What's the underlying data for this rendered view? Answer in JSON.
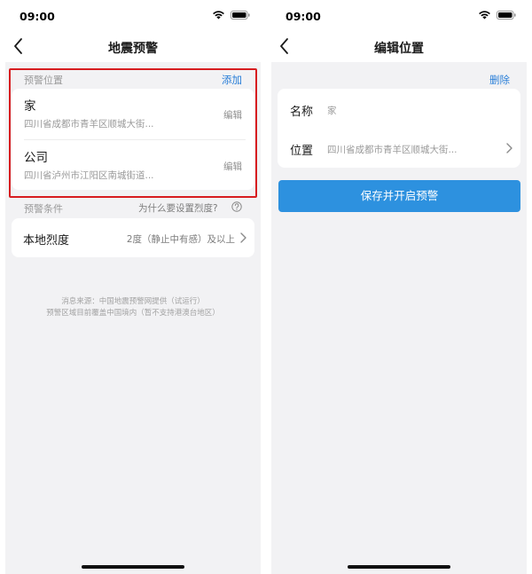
{
  "status_bar": {
    "time": "09:00"
  },
  "left_screen": {
    "title": "地震预警",
    "warning_location": {
      "section_label": "预警位置",
      "add_label": "添加",
      "items": [
        {
          "name": "家",
          "address": "四川省成都市青羊区顺城大街...",
          "edit_label": "编辑"
        },
        {
          "name": "公司",
          "address": "四川省泸州市江阳区南城街道...",
          "edit_label": "编辑"
        }
      ]
    },
    "warning_condition": {
      "section_label": "预警条件",
      "why_label": "为什么要设置烈度?"
    },
    "local_intensity": {
      "label": "本地烈度",
      "value": "2度（静止中有感）及以上"
    },
    "footer": {
      "line1": "消息来源：中国地震预警网提供（试运行）",
      "line2": "预警区域目前覆盖中国境内（暂不支持港澳台地区）"
    }
  },
  "right_screen": {
    "title": "编辑位置",
    "delete_label": "删除",
    "name_field": {
      "label": "名称",
      "value": "家"
    },
    "location_field": {
      "label": "位置",
      "value": "四川省成都市青羊区顺城大街..."
    },
    "save_button_label": "保存并开启预警"
  },
  "colors": {
    "accent_blue": "#2d91df",
    "link_blue": "#2a7fd8",
    "highlight_red": "#d71d20",
    "background": "#f2f2f4"
  },
  "icons": [
    "back-icon",
    "wifi-icon",
    "battery-icon",
    "help-icon",
    "chevron-right-icon"
  ]
}
